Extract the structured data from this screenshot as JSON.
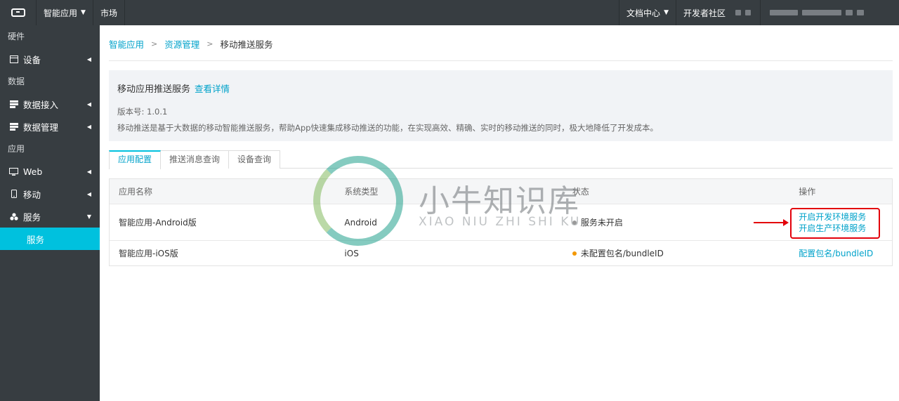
{
  "topbar": {
    "app_menu": "智能应用",
    "market": "市场",
    "docs": "文档中心",
    "community": "开发者社区"
  },
  "sidebar": {
    "groups": {
      "hardware": "硬件",
      "data": "数据",
      "apps": "应用"
    },
    "items": {
      "device": "设备",
      "data_ingest": "数据接入",
      "data_manage": "数据管理",
      "web": "Web",
      "mobile": "移动",
      "service": "服务",
      "service_sub": "服务"
    }
  },
  "breadcrumb": [
    "智能应用",
    "资源管理",
    "移动推送服务"
  ],
  "info": {
    "title": "移动应用推送服务",
    "details_link": "查看详情",
    "version_label": "版本号:",
    "version": "1.0.1",
    "description": "移动推送是基于大数据的移动智能推送服务，帮助App快速集成移动推送的功能，在实现高效、精确、实时的移动推送的同时，极大地降低了开发成本。"
  },
  "tabs": [
    "应用配置",
    "推送消息查询",
    "设备查询"
  ],
  "table": {
    "headers": [
      "应用名称",
      "系统类型",
      "状态",
      "操作"
    ],
    "rows": [
      {
        "name": "智能应用-Android版",
        "os": "Android",
        "status": "服务未开启",
        "status_color": "#999999",
        "actions": [
          "开启开发环境服务",
          "开启生产环境服务"
        ]
      },
      {
        "name": "智能应用-iOS版",
        "os": "iOS",
        "status": "未配置包名/bundleID",
        "status_color": "#f39800",
        "actions": [
          "配置包名/bundleID"
        ]
      }
    ]
  },
  "watermark": {
    "title": "小牛知识库",
    "subtitle": "XIAO NIU ZHI SHI KU"
  },
  "colors": {
    "accent": "#00c1de",
    "link": "#00a2ca",
    "nav_bg": "#373d41",
    "highlight": "#e3000b"
  }
}
